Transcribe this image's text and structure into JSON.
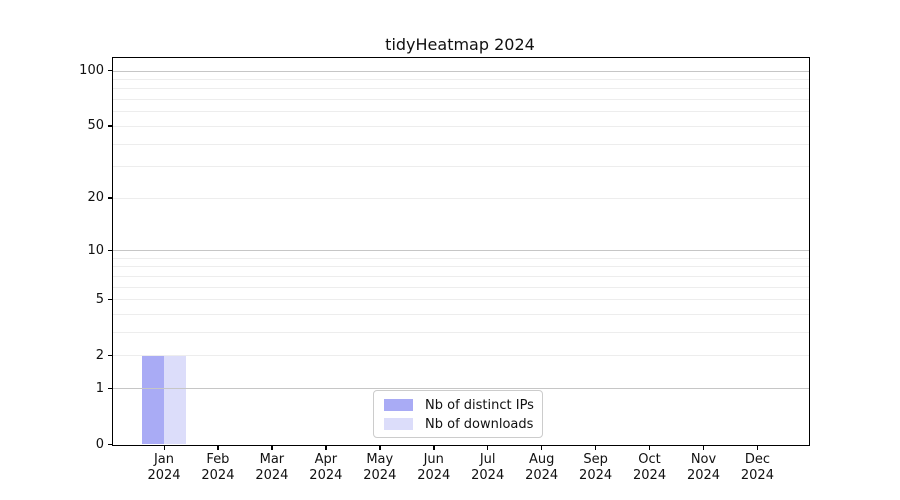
{
  "chart_data": {
    "type": "bar",
    "title": "tidyHeatmap 2024",
    "x_categories": [
      {
        "label": "Jan",
        "sublabel": "2024"
      },
      {
        "label": "Feb",
        "sublabel": "2024"
      },
      {
        "label": "Mar",
        "sublabel": "2024"
      },
      {
        "label": "Apr",
        "sublabel": "2024"
      },
      {
        "label": "May",
        "sublabel": "2024"
      },
      {
        "label": "Jun",
        "sublabel": "2024"
      },
      {
        "label": "Jul",
        "sublabel": "2024"
      },
      {
        "label": "Aug",
        "sublabel": "2024"
      },
      {
        "label": "Sep",
        "sublabel": "2024"
      },
      {
        "label": "Oct",
        "sublabel": "2024"
      },
      {
        "label": "Nov",
        "sublabel": "2024"
      },
      {
        "label": "Dec",
        "sublabel": "2024"
      }
    ],
    "series": [
      {
        "name": "Nb of distinct IPs",
        "color": "#a9abf5",
        "values": [
          2,
          0,
          0,
          0,
          0,
          0,
          0,
          0,
          0,
          0,
          0,
          0
        ]
      },
      {
        "name": "Nb of downloads",
        "color": "#dcddfa",
        "values": [
          2,
          0,
          0,
          0,
          0,
          0,
          0,
          0,
          0,
          0,
          0,
          0
        ]
      }
    ],
    "y_axis": {
      "scale": "log1p",
      "ticks": [
        0,
        1,
        2,
        5,
        10,
        20,
        50,
        100
      ],
      "major_gridlines": [
        1,
        10,
        100
      ],
      "minor_gridlines": [
        2,
        3,
        4,
        5,
        6,
        7,
        8,
        9,
        20,
        30,
        40,
        50,
        60,
        70,
        80,
        90
      ],
      "range": [
        0,
        116
      ]
    },
    "grid": "horizontal",
    "legend_position": "bottom-center",
    "colors": {
      "major_grid": "#c6c6c6",
      "minor_grid": "#ededed",
      "spine": "#000000",
      "text": "#111111",
      "background": "#ffffff"
    }
  }
}
